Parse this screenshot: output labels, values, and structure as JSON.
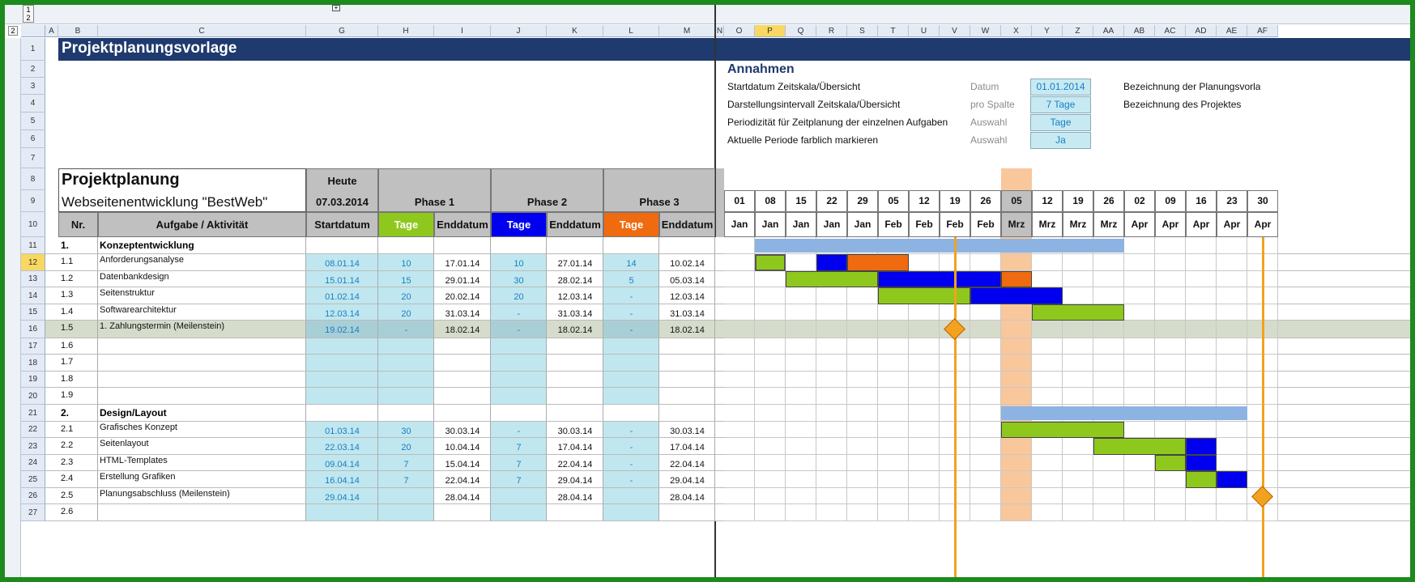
{
  "sheet": {
    "title": "Projektplanungsvorlage",
    "outline_levels": [
      "1",
      "2"
    ],
    "outline_level_row": "2",
    "columns_left": [
      "A",
      "B",
      "C",
      "G",
      "H",
      "I",
      "J",
      "K",
      "L",
      "M",
      "N"
    ],
    "columns_right": [
      "O",
      "P",
      "Q",
      "R",
      "S",
      "T",
      "U",
      "V",
      "W",
      "X",
      "Y",
      "Z",
      "AA",
      "AB",
      "AC",
      "AD",
      "AE",
      "AF"
    ],
    "selected_column": "P",
    "selected_row": "12"
  },
  "assumptions": {
    "heading": "Annahmen",
    "rows": [
      {
        "label": "Startdatum Zeitskala/Übersicht",
        "kind": "Datum",
        "value": "01.01.2014",
        "right_label": "Bezeichnung der Planungsvorla"
      },
      {
        "label": "Darstellungsintervall Zeitskala/Übersicht",
        "kind": "pro Spalte",
        "value": "7 Tage",
        "right_label": "Bezeichnung des Projektes"
      },
      {
        "label": "Periodizität für Zeitplanung der einzelnen Aufgaben",
        "kind": "Auswahl",
        "value": "Tage",
        "right_label": ""
      },
      {
        "label": "Aktuelle Periode farblich markieren",
        "kind": "Auswahl",
        "value": "Ja",
        "right_label": ""
      }
    ]
  },
  "plan": {
    "title": "Projektplanung",
    "subtitle": "Webseitenentwicklung \"BestWeb\"",
    "today_label": "Heute",
    "today_value": "07.03.2014",
    "phase1": "Phase 1",
    "phase2": "Phase 2",
    "phase3": "Phase 3",
    "col_nr": "Nr.",
    "col_task": "Aufgabe / Aktivität",
    "col_start": "Startdatum",
    "col_days": "Tage",
    "col_end": "Enddatum",
    "colors": {
      "phase1": "#8fc81d",
      "phase2": "#0000ee",
      "phase3": "#f06a0f",
      "summary": "#8db3e2",
      "today_column": "#f9c79c",
      "milestone": "#f2a21e"
    }
  },
  "timeline": {
    "days": [
      "01",
      "08",
      "15",
      "22",
      "29",
      "05",
      "12",
      "19",
      "26",
      "05",
      "12",
      "19",
      "26",
      "02",
      "09",
      "16",
      "23",
      "30"
    ],
    "months": [
      "Jan",
      "Jan",
      "Jan",
      "Jan",
      "Jan",
      "Feb",
      "Feb",
      "Feb",
      "Feb",
      "Mrz",
      "Mrz",
      "Mrz",
      "Mrz",
      "Apr",
      "Apr",
      "Apr",
      "Apr",
      "Apr"
    ],
    "today_index": 9
  },
  "rows": [
    {
      "n": "11",
      "nr": "1.",
      "task": "Konzeptentwicklung",
      "section": true,
      "summary": [
        1,
        13
      ]
    },
    {
      "n": "12",
      "nr": "1.1",
      "task": "Anforderungsanalyse",
      "start": "08.01.14",
      "t1": "10",
      "e1": "17.01.14",
      "t2": "10",
      "e2": "27.01.14",
      "t3": "14",
      "e3": "10.02.14",
      "bars": [
        [
          1,
          2,
          "phase1"
        ],
        [
          3,
          4,
          "phase2"
        ],
        [
          4,
          6,
          "phase3"
        ]
      ]
    },
    {
      "n": "13",
      "nr": "1.2",
      "task": "Datenbankdesign",
      "start": "15.01.14",
      "t1": "15",
      "e1": "29.01.14",
      "t2": "30",
      "e2": "28.02.14",
      "t3": "5",
      "e3": "05.03.14",
      "bars": [
        [
          2,
          5,
          "phase1"
        ],
        [
          5,
          9,
          "phase2"
        ],
        [
          9,
          10,
          "phase3"
        ]
      ]
    },
    {
      "n": "14",
      "nr": "1.3",
      "task": "Seitenstruktur",
      "start": "01.02.14",
      "t1": "20",
      "e1": "20.02.14",
      "t2": "20",
      "e2": "12.03.14",
      "t3": "-",
      "e3": "12.03.14",
      "bars": [
        [
          5,
          8,
          "phase1"
        ],
        [
          8,
          11,
          "phase2"
        ]
      ]
    },
    {
      "n": "15",
      "nr": "1.4",
      "task": "Softwarearchitektur",
      "start": "12.03.14",
      "t1": "20",
      "e1": "31.03.14",
      "t2": "-",
      "e2": "31.03.14",
      "t3": "-",
      "e3": "31.03.14",
      "bars": [
        [
          10,
          13,
          "phase1"
        ]
      ]
    },
    {
      "n": "16",
      "nr": "1.5",
      "task": "1. Zahlungstermin  (Meilenstein)",
      "start": "19.02.14",
      "t1": "-",
      "e1": "18.02.14",
      "t2": "-",
      "e2": "18.02.14",
      "t3": "-",
      "e3": "18.02.14",
      "milestone": 7,
      "highlight": true
    },
    {
      "n": "17",
      "nr": "1.6",
      "task": ""
    },
    {
      "n": "18",
      "nr": "1.7",
      "task": ""
    },
    {
      "n": "19",
      "nr": "1.8",
      "task": ""
    },
    {
      "n": "20",
      "nr": "1.9",
      "task": ""
    },
    {
      "n": "21",
      "nr": "2.",
      "task": "Design/Layout",
      "section": true,
      "summary": [
        9,
        17
      ]
    },
    {
      "n": "22",
      "nr": "2.1",
      "task": "Grafisches Konzept",
      "start": "01.03.14",
      "t1": "30",
      "e1": "30.03.14",
      "t2": "-",
      "e2": "30.03.14",
      "t3": "-",
      "e3": "30.03.14",
      "bars": [
        [
          9,
          13,
          "phase1"
        ]
      ]
    },
    {
      "n": "23",
      "nr": "2.2",
      "task": "Seitenlayout",
      "start": "22.03.14",
      "t1": "20",
      "e1": "10.04.14",
      "t2": "7",
      "e2": "17.04.14",
      "t3": "-",
      "e3": "17.04.14",
      "bars": [
        [
          12,
          15,
          "phase1"
        ],
        [
          15,
          16,
          "phase2"
        ]
      ]
    },
    {
      "n": "24",
      "nr": "2.3",
      "task": "HTML-Templates",
      "start": "09.04.14",
      "t1": "7",
      "e1": "15.04.14",
      "t2": "7",
      "e2": "22.04.14",
      "t3": "-",
      "e3": "22.04.14",
      "bars": [
        [
          14,
          15,
          "phase1"
        ],
        [
          15,
          16,
          "phase2"
        ]
      ]
    },
    {
      "n": "25",
      "nr": "2.4",
      "task": "Erstellung Grafiken",
      "start": "16.04.14",
      "t1": "7",
      "e1": "22.04.14",
      "t2": "7",
      "e2": "29.04.14",
      "t3": "-",
      "e3": "29.04.14",
      "bars": [
        [
          15,
          16,
          "phase1"
        ],
        [
          16,
          17,
          "phase2"
        ]
      ]
    },
    {
      "n": "26",
      "nr": "2.5",
      "task": "Planungsabschluss (Meilenstein)",
      "start": "29.04.14",
      "t1": "",
      "e1": "28.04.14",
      "t2": "",
      "e2": "28.04.14",
      "t3": "",
      "e3": "28.04.14",
      "milestone": 17
    },
    {
      "n": "27",
      "nr": "2.6",
      "task": ""
    }
  ],
  "header_rows": [
    "1",
    "2",
    "3",
    "4",
    "5",
    "6",
    "7",
    "8",
    "9",
    "10"
  ]
}
